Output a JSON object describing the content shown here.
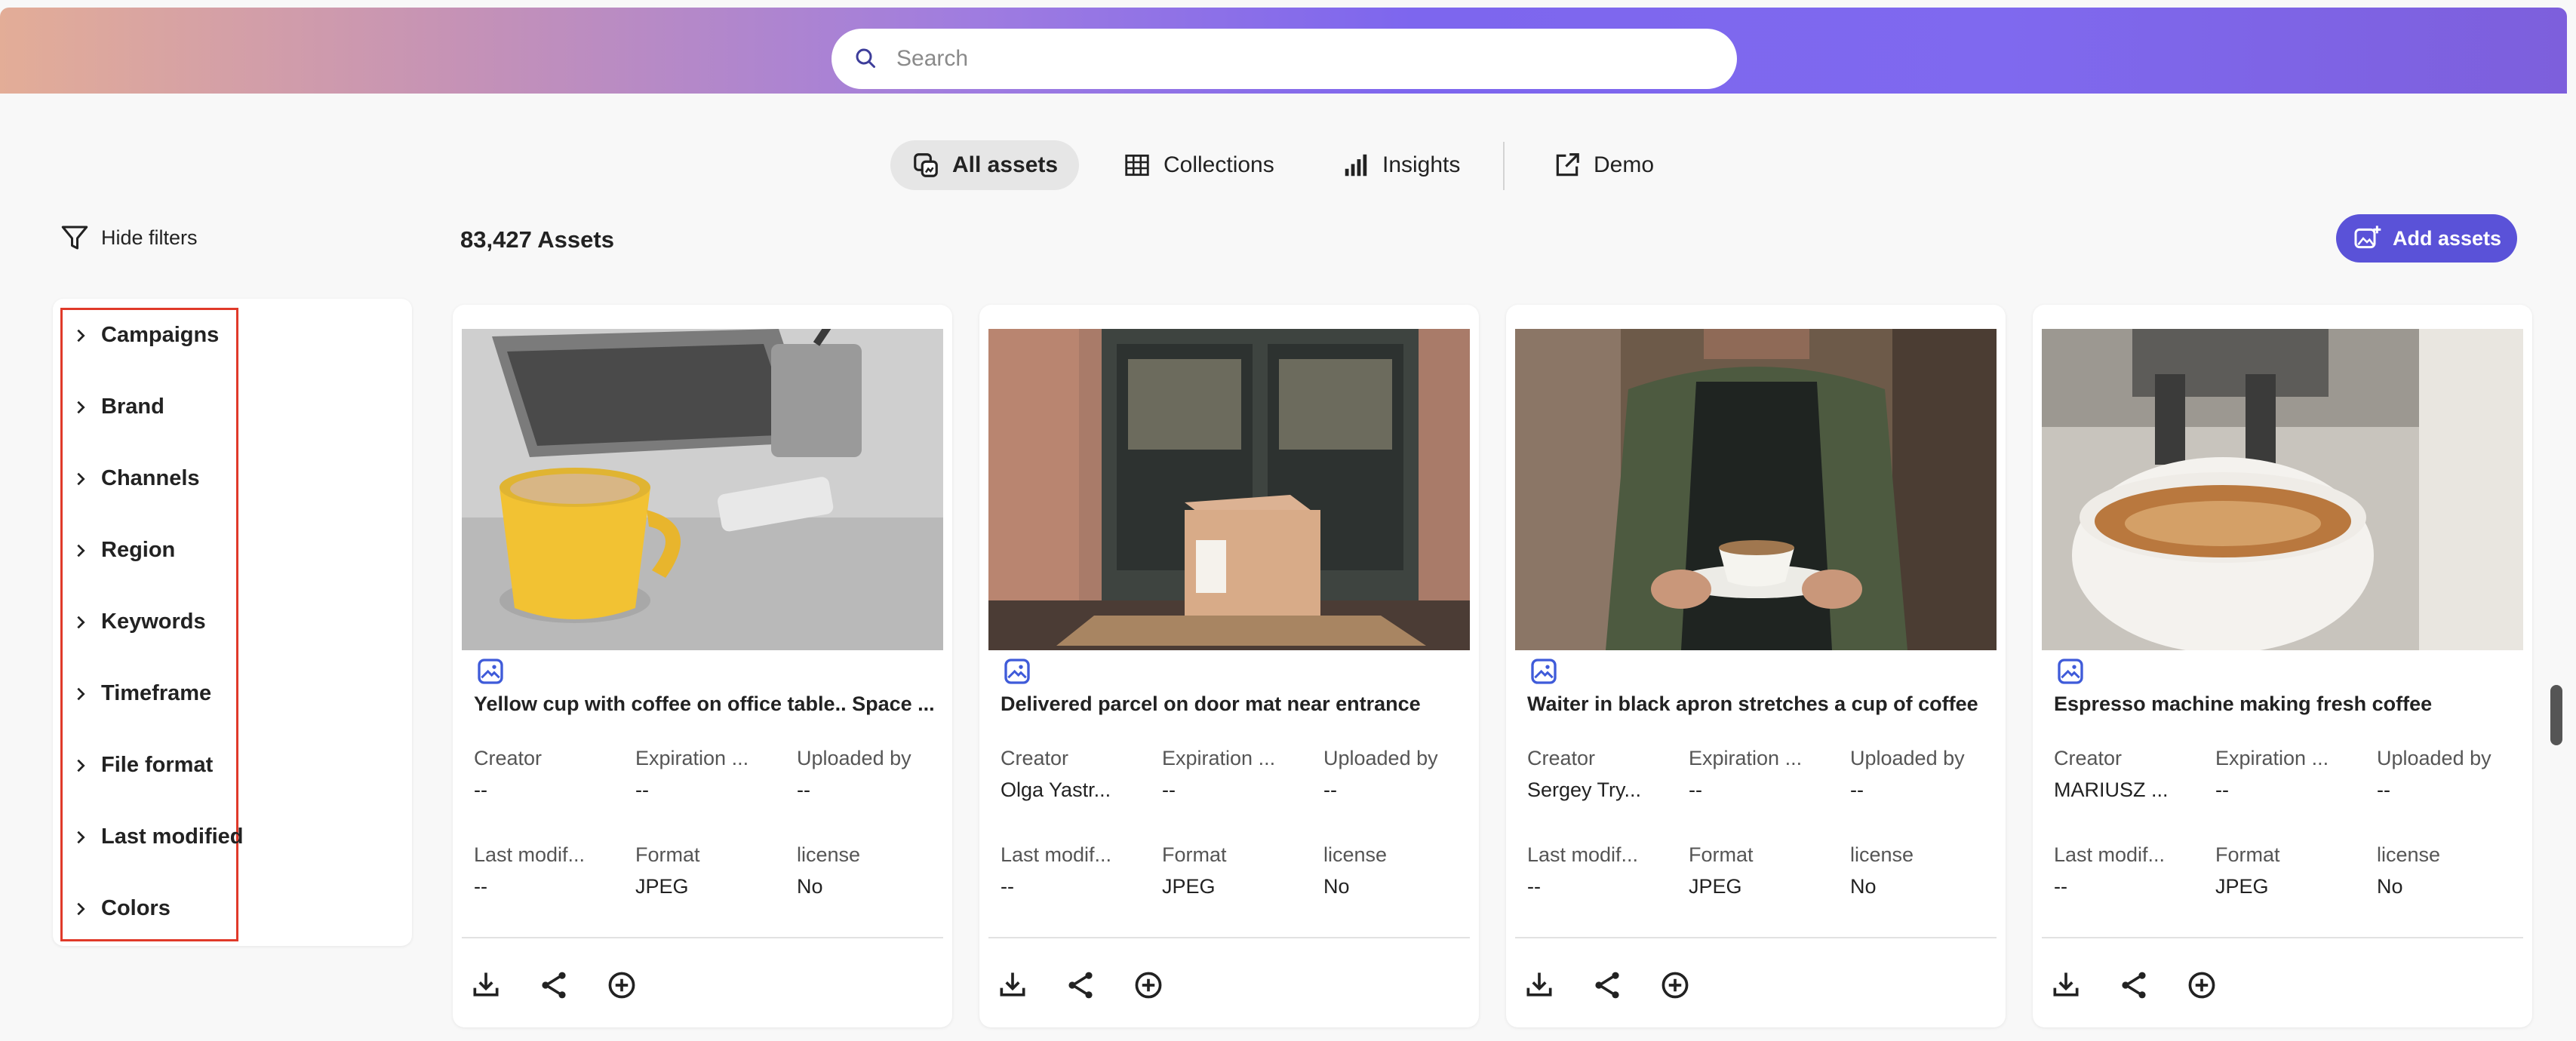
{
  "search": {
    "placeholder": "Search"
  },
  "tabs": [
    {
      "label": "All assets",
      "icon": "assets-icon"
    },
    {
      "label": "Collections",
      "icon": "grid-icon"
    },
    {
      "label": "Insights",
      "icon": "bar-chart-icon"
    },
    {
      "label": "Demo",
      "icon": "external-link-icon"
    }
  ],
  "toolbar": {
    "hide_filters_label": "Hide filters",
    "asset_count": "83,427 Assets",
    "add_assets_label": "Add assets"
  },
  "filters": [
    "Campaigns",
    "Brand",
    "Channels",
    "Region",
    "Keywords",
    "Timeframe",
    "File format",
    "Last modified",
    "Colors"
  ],
  "labels": {
    "creator": "Creator",
    "expiration": "Expiration ...",
    "uploaded_by": "Uploaded by",
    "last_modified": "Last modif...",
    "format": "Format",
    "license": "license"
  },
  "cards": [
    {
      "title": "Yellow cup with coffee on office table.. Space ...",
      "creator": "--",
      "expiration": "--",
      "uploaded_by": "--",
      "last_modified": "--",
      "format": "JPEG",
      "license": "No"
    },
    {
      "title": "Delivered parcel on door mat near entrance",
      "creator": "Olga Yastr...",
      "expiration": "--",
      "uploaded_by": "--",
      "last_modified": "--",
      "format": "JPEG",
      "license": "No"
    },
    {
      "title": "Waiter in black apron stretches a cup of coffee",
      "creator": "Sergey Try...",
      "expiration": "--",
      "uploaded_by": "--",
      "last_modified": "--",
      "format": "JPEG",
      "license": "No"
    },
    {
      "title": "Espresso machine making fresh coffee",
      "creator": "MARIUSZ ...",
      "expiration": "--",
      "uploaded_by": "--",
      "last_modified": "--",
      "format": "JPEG",
      "license": "No"
    }
  ],
  "colors": {
    "accent": "#5a52d8",
    "highlight_box": "#e03a2a",
    "asset_type_icon": "#3f5bd9"
  }
}
